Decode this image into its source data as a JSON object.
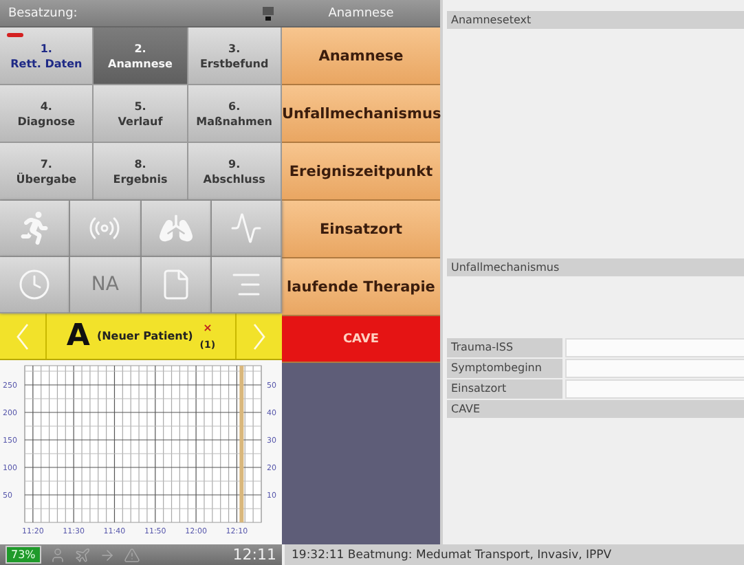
{
  "crew_header": {
    "title": "Besatzung:"
  },
  "nav_buttons": [
    {
      "number": "1.",
      "label": "Rett. Daten",
      "selected": false,
      "flagged": true
    },
    {
      "number": "2.",
      "label": "Anamnese",
      "selected": true,
      "flagged": false
    },
    {
      "number": "3.",
      "label": "Erstbefund",
      "selected": false,
      "flagged": false
    },
    {
      "number": "4.",
      "label": "Diagnose",
      "selected": false,
      "flagged": false
    },
    {
      "number": "5.",
      "label": "Verlauf",
      "selected": false,
      "flagged": false
    },
    {
      "number": "6.",
      "label": "Maßnahmen",
      "selected": false,
      "flagged": false
    },
    {
      "number": "7.",
      "label": "Übergabe",
      "selected": false,
      "flagged": false
    },
    {
      "number": "8.",
      "label": "Ergebnis",
      "selected": false,
      "flagged": false
    },
    {
      "number": "9.",
      "label": "Abschluss",
      "selected": false,
      "flagged": false
    }
  ],
  "tool_buttons": [
    {
      "kind": "runner"
    },
    {
      "kind": "radio"
    },
    {
      "kind": "lungs"
    },
    {
      "kind": "pulse"
    },
    {
      "kind": "clock"
    },
    {
      "kind": "text",
      "label": "NA"
    },
    {
      "kind": "document"
    },
    {
      "kind": "list"
    }
  ],
  "patient_bar": {
    "letter": "A",
    "name": "(Neuer Patient)",
    "marker": "×",
    "count": "(1)"
  },
  "chart": {
    "right_axis_labels": [
      "50",
      "40",
      "30",
      "20",
      "10"
    ],
    "chart_data": {
      "type": "line",
      "ylim": [
        0,
        285
      ],
      "yticks": [
        50,
        100,
        150,
        200,
        250
      ],
      "categories": [
        "11:20",
        "11:30",
        "11:40",
        "11:50",
        "12:00",
        "12:10"
      ],
      "grid": true
    }
  },
  "section_header": {
    "title": "Anamnese"
  },
  "section_buttons": [
    {
      "label": "Anamnese",
      "kind": "normal"
    },
    {
      "label": "Unfallmechanismus",
      "kind": "normal"
    },
    {
      "label": "Ereigniszeitpunkt",
      "kind": "normal"
    },
    {
      "label": "Einsatzort",
      "kind": "normal"
    },
    {
      "label": "laufende Therapie",
      "kind": "normal"
    },
    {
      "label": "CAVE",
      "kind": "alert"
    }
  ],
  "text_areas": [
    {
      "label": "Anamnesetext"
    },
    {
      "label": "Unfallmechanismus"
    }
  ],
  "fields": [
    {
      "label": "Trauma-ISS"
    },
    {
      "label": "Symptombeginn"
    },
    {
      "label": "Einsatzort"
    }
  ],
  "cave_area": {
    "label": "CAVE"
  },
  "status_bar": {
    "battery": "73%",
    "time": "12:11",
    "message": "19:32:11 Beatmung: Medumat Transport, Invasiv, IPPV"
  }
}
